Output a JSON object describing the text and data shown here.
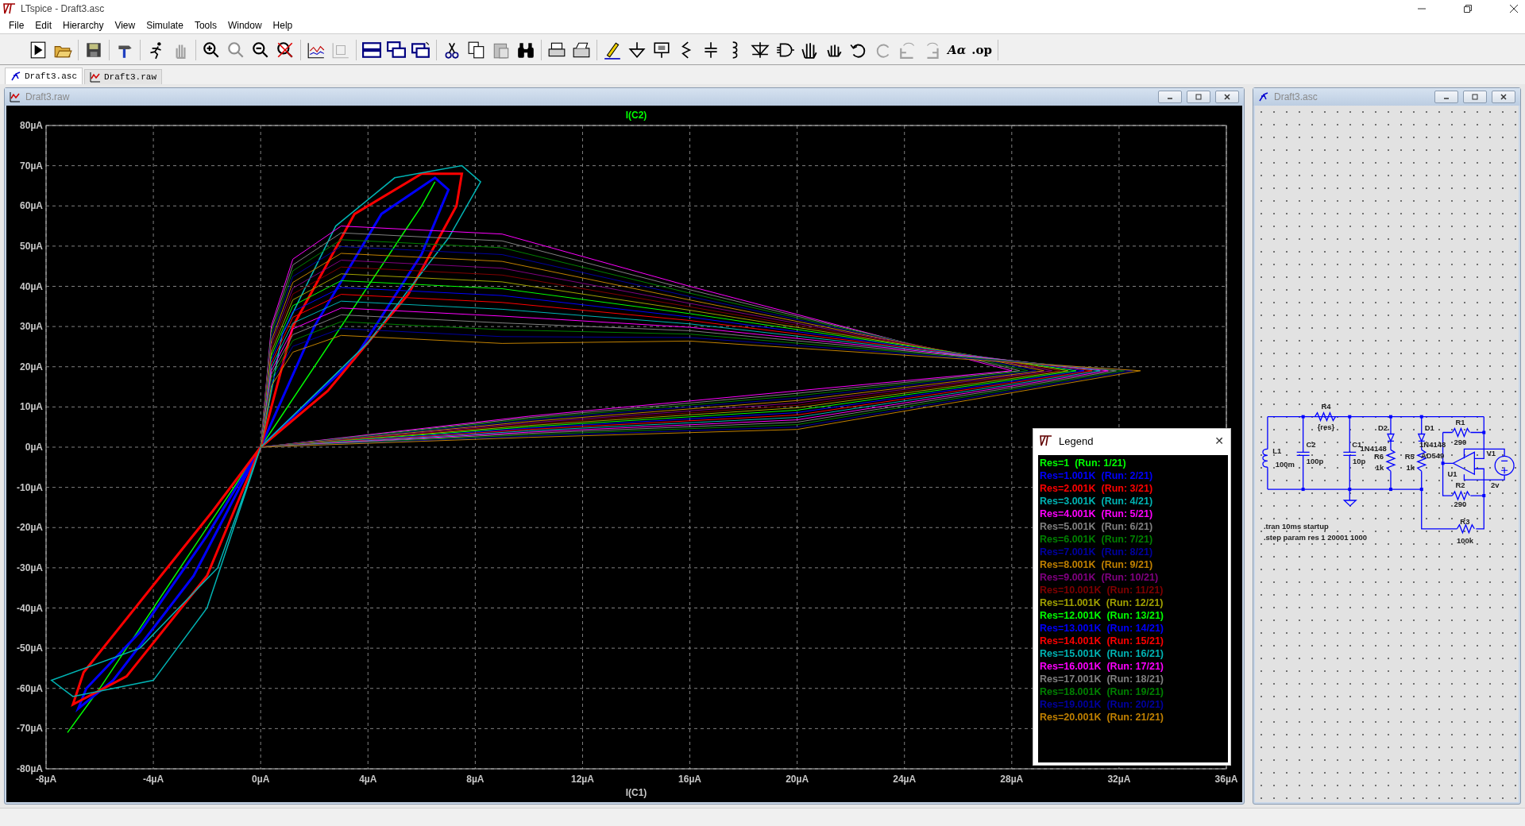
{
  "window": {
    "title": "LTspice - Draft3.asc"
  },
  "menu": [
    "File",
    "Edit",
    "Hierarchy",
    "View",
    "Simulate",
    "Tools",
    "Window",
    "Help"
  ],
  "toolbar": {
    "text_buttons": [
      "Aα",
      ".op"
    ]
  },
  "doc_tabs": [
    {
      "label": "Draft3.asc",
      "kind": "schematic",
      "selected": true
    },
    {
      "label": "Draft3.raw",
      "kind": "waveform",
      "selected": false
    }
  ],
  "plot_window": {
    "title": "Draft3.raw",
    "chart_data": {
      "type": "line",
      "grid": true,
      "xlabel": "I(C1)",
      "ylabel": "I(C2)",
      "xlim": [
        -8,
        36
      ],
      "ylim": [
        -80,
        80
      ],
      "xticks": [
        {
          "value": -8,
          "label": "-8µA"
        },
        {
          "value": -4,
          "label": "-4µA"
        },
        {
          "value": 0,
          "label": "0µA"
        },
        {
          "value": 4,
          "label": "4µA"
        },
        {
          "value": 8,
          "label": "8µA"
        },
        {
          "value": 12,
          "label": "12µA"
        },
        {
          "value": 16,
          "label": "16µA"
        },
        {
          "value": 20,
          "label": "20µA"
        },
        {
          "value": 24,
          "label": "24µA"
        },
        {
          "value": 28,
          "label": "28µA"
        },
        {
          "value": 32,
          "label": "32µA"
        },
        {
          "value": 36,
          "label": "36µA"
        }
      ],
      "yticks": [
        {
          "value": 80,
          "label": "80µA"
        },
        {
          "value": 70,
          "label": "70µA"
        },
        {
          "value": 60,
          "label": "60µA"
        },
        {
          "value": 50,
          "label": "50µA"
        },
        {
          "value": 40,
          "label": "40µA"
        },
        {
          "value": 30,
          "label": "30µA"
        },
        {
          "value": 20,
          "label": "20µA"
        },
        {
          "value": 10,
          "label": "10µA"
        },
        {
          "value": 0,
          "label": "0µA"
        },
        {
          "value": -10,
          "label": "-10µA"
        },
        {
          "value": -20,
          "label": "-20µA"
        },
        {
          "value": -30,
          "label": "-30µA"
        },
        {
          "value": -40,
          "label": "-40µA"
        },
        {
          "value": -50,
          "label": "-50µA"
        },
        {
          "value": -60,
          "label": "-60µA"
        },
        {
          "value": -70,
          "label": "-70µA"
        },
        {
          "value": -80,
          "label": "-80µA"
        }
      ]
    }
  },
  "legend": {
    "title": "Legend",
    "close": "✕",
    "items": [
      {
        "label": "Res=1",
        "run": "(Run: 1/21)",
        "color": "#00ff00"
      },
      {
        "label": "Res=1.001K",
        "run": "(Run: 2/21)",
        "color": "#0000ff"
      },
      {
        "label": "Res=2.001K",
        "run": "(Run: 3/21)",
        "color": "#ff0000"
      },
      {
        "label": "Res=3.001K",
        "run": "(Run: 4/21)",
        "color": "#00b4b4"
      },
      {
        "label": "Res=4.001K",
        "run": "(Run: 5/21)",
        "color": "#ff00ff"
      },
      {
        "label": "Res=5.001K",
        "run": "(Run: 6/21)",
        "color": "#808080"
      },
      {
        "label": "Res=6.001K",
        "run": "(Run: 7/21)",
        "color": "#008000"
      },
      {
        "label": "Res=7.001K",
        "run": "(Run: 8/21)",
        "color": "#0000a0"
      },
      {
        "label": "Res=8.001K",
        "run": "(Run: 9/21)",
        "color": "#c08000"
      },
      {
        "label": "Res=9.001K",
        "run": "(Run: 10/21)",
        "color": "#800080"
      },
      {
        "label": "Res=10.001K",
        "run": "(Run: 11/21)",
        "color": "#800000"
      },
      {
        "label": "Res=11.001K",
        "run": "(Run: 12/21)",
        "color": "#a0a000"
      },
      {
        "label": "Res=12.001K",
        "run": "(Run: 13/21)",
        "color": "#00ff00"
      },
      {
        "label": "Res=13.001K",
        "run": "(Run: 14/21)",
        "color": "#0000ff"
      },
      {
        "label": "Res=14.001K",
        "run": "(Run: 15/21)",
        "color": "#ff0000"
      },
      {
        "label": "Res=15.001K",
        "run": "(Run: 16/21)",
        "color": "#00b4b4"
      },
      {
        "label": "Res=16.001K",
        "run": "(Run: 17/21)",
        "color": "#ff00ff"
      },
      {
        "label": "Res=17.001K",
        "run": "(Run: 18/21)",
        "color": "#808080"
      },
      {
        "label": "Res=18.001K",
        "run": "(Run: 19/21)",
        "color": "#008000"
      },
      {
        "label": "Res=19.001K",
        "run": "(Run: 20/21)",
        "color": "#0000a0"
      },
      {
        "label": "Res=20.001K",
        "run": "(Run: 21/21)",
        "color": "#c08000"
      }
    ]
  },
  "schematic_window": {
    "title": "Draft3.asc",
    "labels": [
      "R4",
      "{res}",
      "L1",
      "100m",
      "C2",
      "100p",
      "C1",
      "10p",
      "D2",
      "1N4148",
      "R6",
      "1k",
      "R5",
      "1k",
      "D1",
      "1N4148",
      "AD549",
      "R1",
      "290",
      "V1",
      "U1",
      "2v",
      "R2",
      "290",
      "R3",
      "100k"
    ],
    "directives": [
      ".tran 10ms startup",
      ".step param res 1 20001 1000"
    ]
  }
}
